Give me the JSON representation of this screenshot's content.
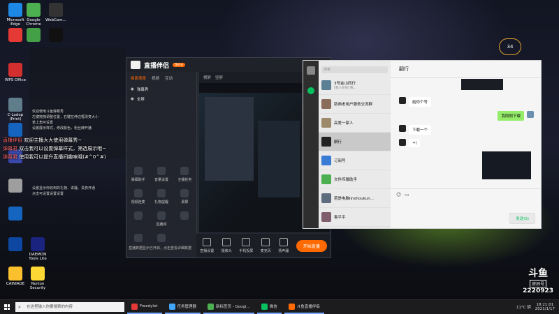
{
  "desktop_icons": [
    {
      "label": "Microsoft Edge",
      "color": "#1e88e5"
    },
    {
      "label": "Google Chrome",
      "color": "#4caf50"
    },
    {
      "label": "WebCam...",
      "color": "#333"
    },
    {
      "label": "",
      "color": "#e53935"
    },
    {
      "label": "",
      "color": "#43a047"
    },
    {
      "label": "",
      "color": "#111"
    },
    {
      "label": "WPS Office",
      "color": "#d32f2f"
    },
    {
      "label": "C-Lodop (Print)",
      "color": "#607d8b"
    },
    {
      "label": "",
      "color": "#1565c0"
    },
    {
      "label": "",
      "color": "#3949ab"
    },
    {
      "label": "",
      "color": "#9e9e9e"
    },
    {
      "label": "",
      "color": "#1565c0"
    },
    {
      "label": "",
      "color": "#0d47a1"
    },
    {
      "label": "DAEMON Tools Lite",
      "color": "#1a237e"
    },
    {
      "label": "CAINIAOE",
      "color": "#fbc02d"
    },
    {
      "label": "Norton Security",
      "color": "#fdd835"
    }
  ],
  "overlay": {
    "line1_name": "直播伴侣",
    "line1_text": "欢迎主播大大使用弹幕秀~",
    "line2_name": "弹幕君",
    "line2_text": "双击我可以设置弹幕样式，筛选展示哦~",
    "line3_name": "弹幕君",
    "line3_text": "使用我可以提升直播间趣味哦(#^0^#)"
  },
  "stream_app": {
    "brand": "直播伴侣",
    "version": "Beta",
    "tabs": [
      "画面场景",
      "视频",
      "互动"
    ],
    "sources": [
      "弹幕秀",
      "全屏"
    ],
    "preview_tabs": [
      "横屏",
      "竖屏"
    ],
    "room_id": "2220923",
    "tools": [
      "弹幕助手",
      "音量设置",
      "主播任务",
      "视频连麦",
      "礼物提醒",
      "录屏",
      "",
      "直播间",
      "",
      "",
      ""
    ],
    "bottom": [
      "直播设置",
      "摄像头",
      "手机投屏",
      "麦克风",
      "扬声器"
    ],
    "live_button": "开始直播",
    "notice": "直播数据显示已开启，点击查看详细数据"
  },
  "wechat": {
    "search_placeholder": "搜索",
    "chat_title": "嗣行",
    "contacts": [
      {
        "name": "3号金山同行",
        "sub": "[我人在线] 晚...",
        "time": "",
        "color": "#5b7f93"
      },
      {
        "name": "助商老用户服务交流群",
        "sub": "",
        "time": "",
        "color": "#8a6d5b"
      },
      {
        "name": "高爱一家人",
        "sub": "",
        "time": "",
        "color": "#9c8a6a"
      },
      {
        "name": "嗣行",
        "sub": "",
        "time": "",
        "color": "#222"
      },
      {
        "name": "订阅号",
        "sub": "",
        "time": "",
        "color": "#3a7bd5"
      },
      {
        "name": "文件传输助手",
        "sub": "",
        "time": "",
        "color": "#4caf50"
      },
      {
        "name": "若是电脑linshoukun...",
        "sub": "",
        "time": "",
        "color": "#5d6d7e"
      },
      {
        "name": "鲁平平",
        "sub": "",
        "time": "",
        "color": "#7e5d6d"
      }
    ],
    "messages": [
      {
        "dir": "in",
        "text": "给你个号"
      },
      {
        "dir": "out",
        "text": "我刚刚下载"
      },
      {
        "dir": "in",
        "text": "下载一个"
      },
      {
        "dir": "in",
        "text": "+|"
      }
    ],
    "send_label": "发送(S)"
  },
  "taskbar": {
    "search_placeholder": "在这里输入你要搜索的内容",
    "apps": [
      {
        "label": "Freedylet",
        "color": "#e53935"
      },
      {
        "label": "任务管理器",
        "color": "#42a5f5"
      },
      {
        "label": "新标签页 - Googl...",
        "color": "#4caf50"
      },
      {
        "label": "微信",
        "color": "#07c160"
      },
      {
        "label": "斗鱼直播伴侣",
        "color": "#ff6a00"
      }
    ],
    "weather": "11°C 阴",
    "time": "18:21:01",
    "date": "2021/1/17"
  },
  "douyu": {
    "logo": "斗鱼",
    "tag": "房间号",
    "room": "2220923"
  },
  "weather_widget": "34",
  "chatlog_lines": [
    "欢迎使用斗鱼弹幕秀",
    "左键拖拽调整位置，右键拉伸边框改变大小",
    "若上角可设置",
    "设置展示样式，修改颜色，粉丝牌开播",
    "设置显示你收到的礼物、讲骚、贵族开通",
    "点击可设置设置设置"
  ]
}
